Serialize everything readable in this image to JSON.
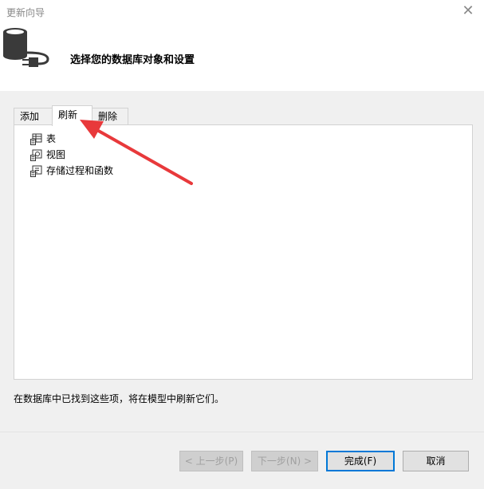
{
  "window": {
    "title": "更新向导",
    "close_glyph": "✕"
  },
  "header": {
    "text": "选择您的数据库对象和设置",
    "icon": "database-plug-icon"
  },
  "tabs": [
    {
      "label": "添加",
      "active": false
    },
    {
      "label": "刷新",
      "active": true
    },
    {
      "label": "删除",
      "active": false
    }
  ],
  "tree": [
    {
      "label": "表",
      "icon": "table-icon"
    },
    {
      "label": "视图",
      "icon": "view-icon"
    },
    {
      "label": "存储过程和函数",
      "icon": "stored-procedure-icon"
    }
  ],
  "status": "在数据库中已找到这些项，将在模型中刷新它们。",
  "buttons": {
    "prev": "< 上一步(P)",
    "next": "下一步(N) >",
    "finish": "完成(F)",
    "cancel": "取消"
  },
  "colors": {
    "accent": "#0078d7",
    "annotation_arrow": "#e8393b"
  }
}
